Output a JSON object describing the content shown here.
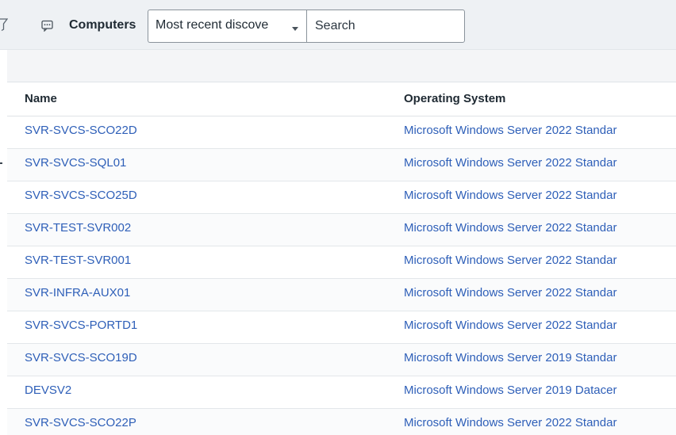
{
  "toolbar": {
    "filter_icon": "filter-icon",
    "context_icon": "context-menu-icon",
    "title": "Computers",
    "view_select": {
      "selected": "Most recent discove",
      "caret_icon": "chevron-down-icon"
    },
    "search": {
      "placeholder": "Search",
      "value": ""
    }
  },
  "table": {
    "columns": [
      "Name",
      "Operating System"
    ],
    "rows": [
      {
        "name": "SVR-SVCS-SCO22D",
        "os": "Microsoft Windows Server 2022 Standar"
      },
      {
        "name": "SVR-SVCS-SQL01",
        "os": "Microsoft Windows Server 2022 Standar"
      },
      {
        "name": "SVR-SVCS-SCO25D",
        "os": "Microsoft Windows Server 2022 Standar"
      },
      {
        "name": "SVR-TEST-SVR002",
        "os": "Microsoft Windows Server 2022 Standar"
      },
      {
        "name": "SVR-TEST-SVR001",
        "os": "Microsoft Windows Server 2022 Standar"
      },
      {
        "name": "SVR-INFRA-AUX01",
        "os": "Microsoft Windows Server 2022 Standar"
      },
      {
        "name": "SVR-SVCS-PORTD1",
        "os": "Microsoft Windows Server 2022 Standar"
      },
      {
        "name": "SVR-SVCS-SCO19D",
        "os": "Microsoft Windows Server 2019 Standar"
      },
      {
        "name": "DEVSV2",
        "os": "Microsoft Windows Server 2019 Datacer"
      },
      {
        "name": "SVR-SVCS-SCO22P",
        "os": "Microsoft Windows Server 2022 Standar"
      }
    ]
  },
  "colors": {
    "link": "#2e5fb8",
    "toolbar_bg": "#eef1f4",
    "text": "#1f2a33"
  }
}
